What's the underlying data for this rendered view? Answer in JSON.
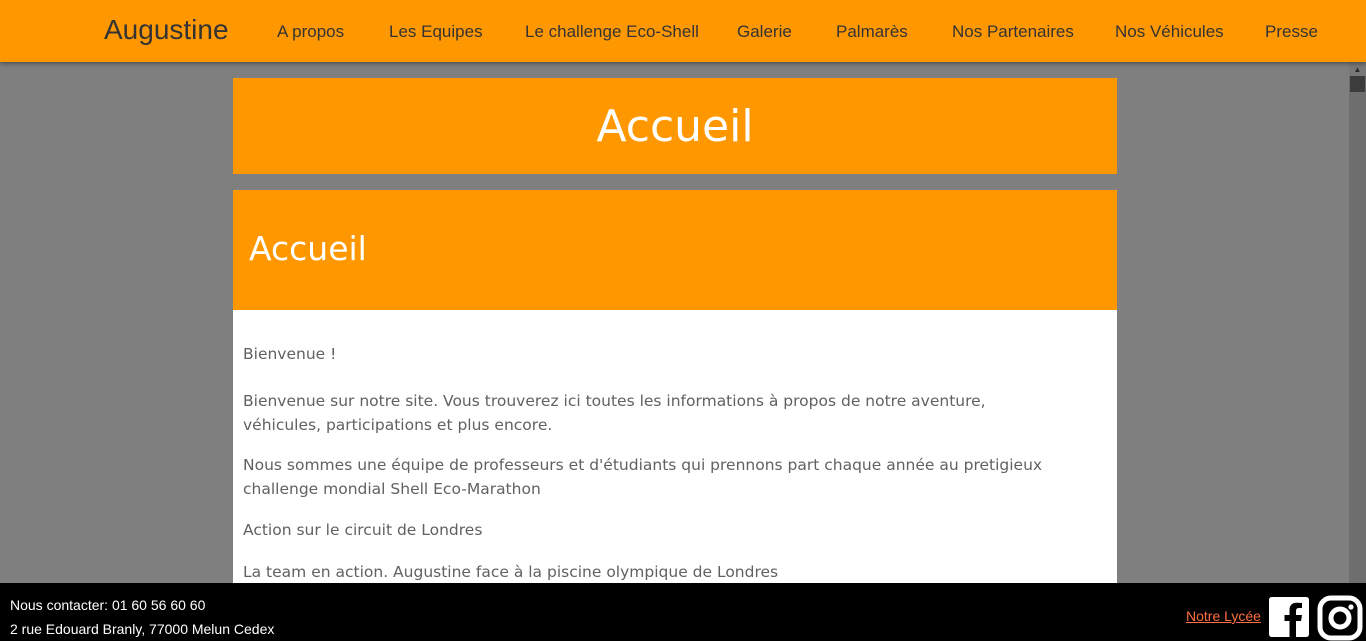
{
  "nav": {
    "brand": "Augustine",
    "items": [
      {
        "label": "A propos"
      },
      {
        "label": "Les Equipes"
      },
      {
        "label": "Le challenge Eco-Shell"
      },
      {
        "label": "Galerie"
      },
      {
        "label": "Palmarès"
      },
      {
        "label": "Nos Partenaires"
      },
      {
        "label": "Nos Véhicules"
      },
      {
        "label": "Presse"
      }
    ]
  },
  "hero": {
    "title": "Accueil"
  },
  "card": {
    "title": "Accueil",
    "paragraphs": [
      "Bienvenue !",
      "Bienvenue sur notre site. Vous trouverez ici toutes les informations à propos de notre aventure, véhicules, participations et plus encore.",
      "Nous sommes une équipe de professeurs et d'étudiants qui prennons part chaque année au pretigieux challenge mondial Shell Eco-Marathon",
      "Action sur le circuit de Londres",
      "La team en action. Augustine face à la piscine olympique de Londres"
    ]
  },
  "footer": {
    "contact": "Nous contacter: 01 60 56 60 60",
    "address": "2 rue Edouard Branly, 77000 Melun Cedex",
    "lycee_link": "Notre Lycée",
    "social_icons": [
      "facebook-icon",
      "instagram-icon"
    ]
  },
  "colors": {
    "accent": "#ff9800",
    "backdrop": "#7f7f7f",
    "footer": "#000000",
    "link": "#ff6e40"
  }
}
